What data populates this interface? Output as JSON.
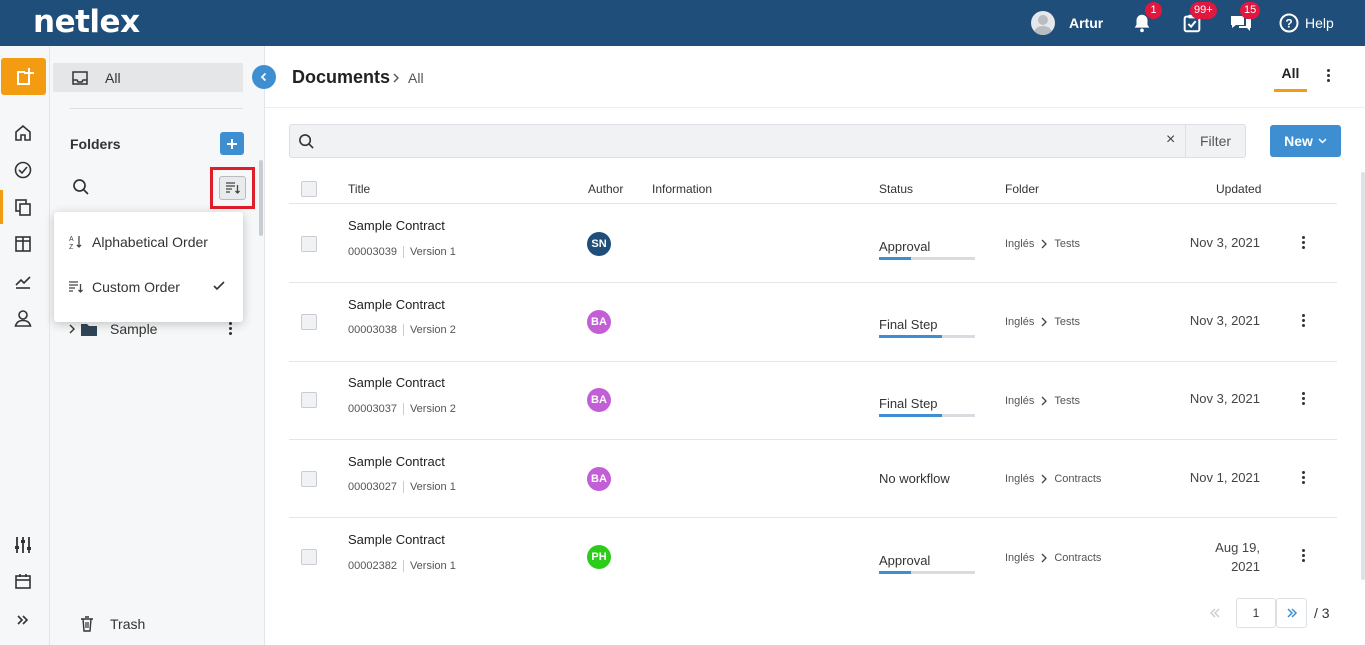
{
  "header": {
    "logo": "netlex",
    "user_name": "Artur",
    "notifications_badge": "1",
    "tasks_badge": "99+",
    "messages_badge": "15",
    "help_label": "Help"
  },
  "sidebar": {
    "all_label": "All",
    "folders_title": "Folders",
    "sort_menu": {
      "alphabetical_label": "Alphabetical Order",
      "custom_label": "Custom Order"
    },
    "folder_item": "Sample",
    "trash_label": "Trash"
  },
  "page": {
    "title": "Documents",
    "breadcrumb": "All",
    "tab_all": "All",
    "filter_label": "Filter",
    "clear_symbol": "×",
    "new_label": "New"
  },
  "table": {
    "columns": [
      "Title",
      "Author",
      "Information",
      "Status",
      "Folder",
      "Updated"
    ],
    "rows": [
      {
        "title": "Sample Contract",
        "number": "00003039",
        "version": "Version 1",
        "author": "SN",
        "author_color": "#1e4e79",
        "status": "Approval",
        "progress": 0.33,
        "folder_root": "Inglés",
        "folder": "Tests",
        "updated": "Nov 3, 2021"
      },
      {
        "title": "Sample Contract",
        "number": "00003038",
        "version": "Version 2",
        "author": "BA",
        "author_color": "#c35fd6",
        "status": "Final Step",
        "progress": 0.66,
        "folder_root": "Inglés",
        "folder": "Tests",
        "updated": "Nov 3, 2021"
      },
      {
        "title": "Sample Contract",
        "number": "00003037",
        "version": "Version 2",
        "author": "BA",
        "author_color": "#c35fd6",
        "status": "Final Step",
        "progress": 0.66,
        "folder_root": "Inglés",
        "folder": "Tests",
        "updated": "Nov 3, 2021"
      },
      {
        "title": "Sample Contract",
        "number": "00003027",
        "version": "Version 1",
        "author": "BA",
        "author_color": "#c35fd6",
        "status": "No workflow",
        "progress": null,
        "folder_root": "Inglés",
        "folder": "Contracts",
        "updated": "Nov 1, 2021"
      },
      {
        "title": "Sample Contract",
        "number": "00002382",
        "version": "Version 1",
        "author": "PH",
        "author_color": "#2ecc1a",
        "status": "Approval",
        "progress": 0.33,
        "folder_root": "Inglés",
        "folder": "Contracts",
        "updated_line1": "Aug 19,",
        "updated_line2": "2021"
      }
    ]
  },
  "pagination": {
    "current_page": "1",
    "total_label": "/ 3"
  },
  "colors": {
    "topbar": "#1e4e79",
    "accent_orange": "#f39c12",
    "primary_blue": "#3d8fd1",
    "badge_red": "#e0183f",
    "highlight_red": "#e01e2a"
  }
}
